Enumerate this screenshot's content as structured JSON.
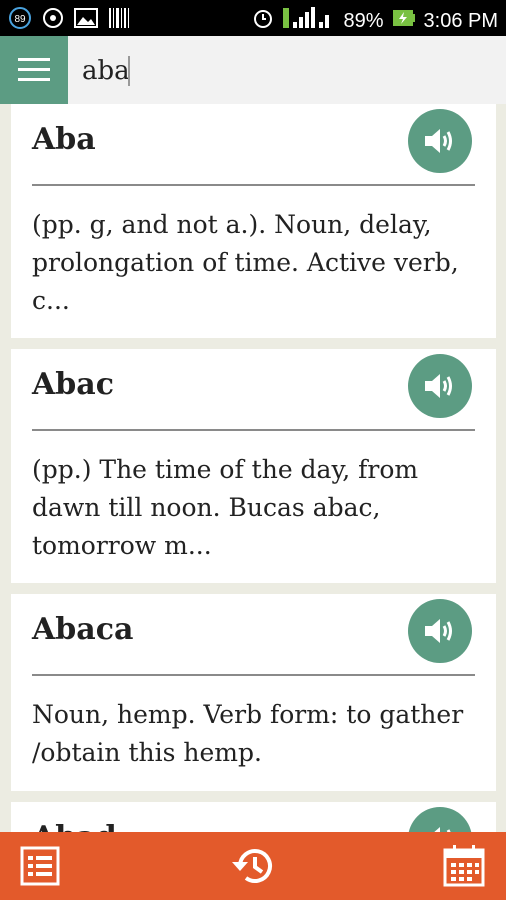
{
  "statusbar": {
    "notif_count": "89",
    "battery_percent": "89%",
    "time": "3:06 PM"
  },
  "search": {
    "value": "aba"
  },
  "entries": [
    {
      "term": "Aba",
      "definition": "(pp. g, and not a.). Noun, delay, prolongation of time. Active verb, c..."
    },
    {
      "term": "Abac",
      "definition": "(pp.) The time of the day, from dawn till noon. Bucas abac, tomorrow m..."
    },
    {
      "term": "Abaca",
      "definition": "Noun, hemp. Verb form: to gather /obtain this hemp."
    },
    {
      "term": "Abad",
      "definition": ""
    }
  ],
  "colors": {
    "accent": "#5c9c83",
    "bottom_bar": "#e35a2b",
    "background": "#ecece2"
  },
  "icons": {
    "menu": "menu-icon",
    "speak": "speaker-icon",
    "list": "list-icon",
    "history": "history-icon",
    "calendar": "calendar-icon"
  }
}
